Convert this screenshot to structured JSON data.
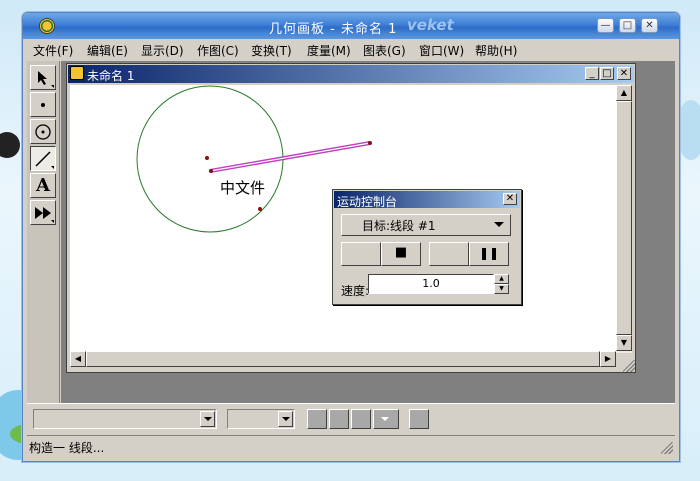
{
  "window": {
    "title": "几何画板 - 未命名 1",
    "watermark": "veket",
    "buttons": {
      "minimize": "—",
      "maximize": "□",
      "close": "✕"
    }
  },
  "menu": [
    {
      "label": "文件(F)"
    },
    {
      "label": "编辑(E)"
    },
    {
      "label": "显示(D)"
    },
    {
      "label": "作图(C)"
    },
    {
      "label": "变换(T)"
    },
    {
      "label": "度量(M)"
    },
    {
      "label": "图表(G)"
    },
    {
      "label": "窗口(W)"
    },
    {
      "label": "帮助(H)"
    }
  ],
  "toolbox": {
    "tools": [
      {
        "name": "selection-arrow-tool",
        "icon": "arrow-icon",
        "active": false
      },
      {
        "name": "point-tool",
        "icon": "point-icon",
        "active": false
      },
      {
        "name": "compass-tool",
        "icon": "circle-icon",
        "active": false
      },
      {
        "name": "straightedge-tool",
        "icon": "segment-icon",
        "active": true
      },
      {
        "name": "text-tool",
        "icon": "text-A-icon",
        "glyph": "A",
        "active": false
      },
      {
        "name": "custom-tool",
        "icon": "fast-forward-icon",
        "active": false
      }
    ]
  },
  "document": {
    "title": "未命名 1",
    "canvas_label": "中文件"
  },
  "motion_controller": {
    "title": "运动控制台",
    "close": "✕",
    "target_label": "目标:线段 #1",
    "stop_glyph": "■",
    "pause_glyph": "❚❚",
    "speed_label": "速度:",
    "speed_value": "1.0"
  },
  "status": {
    "text": "构造一 线段..."
  },
  "colors": {
    "titlebar_blue": "#3f7fd6",
    "circle": "#2a7a2a",
    "segment": "#c040c0",
    "point": "#8b1010"
  }
}
